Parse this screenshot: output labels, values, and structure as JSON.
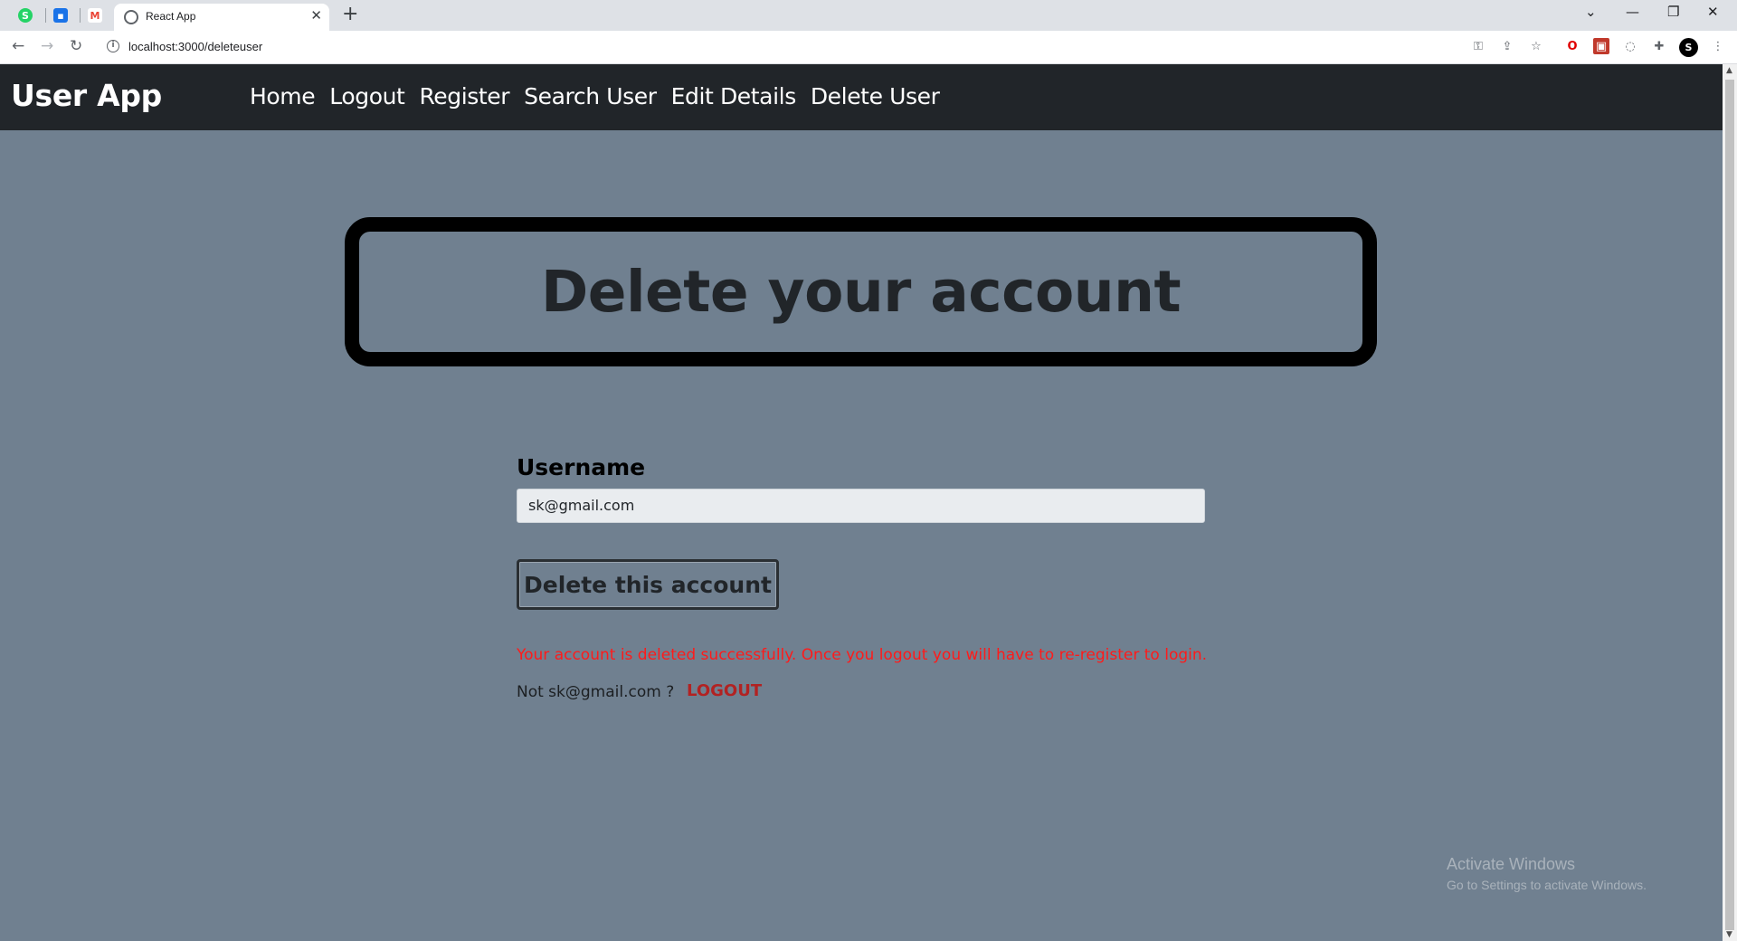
{
  "browser": {
    "tab_title": "React App",
    "url": "localhost:3000/deleteuser",
    "profile_initial": "S",
    "pinned_tabs": [
      {
        "icon": "whatsapp-icon",
        "glyph": "✆",
        "color": "#25d366"
      },
      {
        "icon": "contacts-icon",
        "glyph": "👤",
        "color": "#1a73e8"
      },
      {
        "icon": "gmail-icon",
        "glyph": "M",
        "color": "#ea4335"
      }
    ]
  },
  "navbar": {
    "brand": "User App",
    "links": [
      "Home",
      "Logout",
      "Register",
      "Search User",
      "Edit Details",
      "Delete User"
    ]
  },
  "main": {
    "title": "Delete your account",
    "username_label": "Username",
    "username_value": "sk@gmail.com",
    "delete_button": "Delete this account",
    "success_message": "Your account is deleted successfully. Once you logout you will have to re-register to login.",
    "not_user_text": "Not sk@gmail.com ?",
    "logout_link": "LOGOUT"
  },
  "watermark": {
    "line1": "Activate Windows",
    "line2": "Go to Settings to activate Windows."
  },
  "colors": {
    "page_bg": "#708090",
    "navbar_bg": "#212529",
    "error_text": "#ff1a1a",
    "logout_link": "#b22222"
  }
}
